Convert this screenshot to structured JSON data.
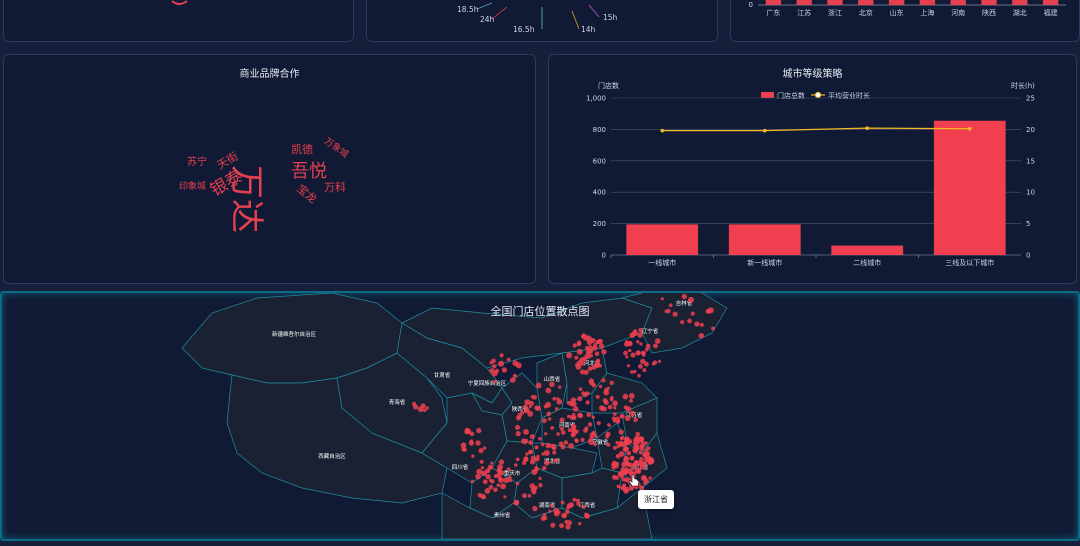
{
  "top_left": {
    "labels": []
  },
  "top_mid": {
    "labels": [
      "18.5h",
      "24h",
      "16.5h",
      "15h",
      "14h"
    ]
  },
  "top_right": {
    "categories": [
      "广东",
      "江苏",
      "浙江",
      "北京",
      "山东",
      "上海",
      "河南",
      "陕西",
      "湖北",
      "福建"
    ],
    "zero": "0"
  },
  "brand_cloud": {
    "title": "商业品牌合作",
    "words": [
      {
        "text": "万达",
        "size": 34
      },
      {
        "text": "银泰",
        "size": 17
      },
      {
        "text": "吾悦",
        "size": 18
      },
      {
        "text": "凯德",
        "size": 11
      },
      {
        "text": "天街",
        "size": 11
      },
      {
        "text": "苏宁",
        "size": 10
      },
      {
        "text": "印象城",
        "size": 9
      },
      {
        "text": "宝龙",
        "size": 11
      },
      {
        "text": "万科",
        "size": 11
      },
      {
        "text": "万象城",
        "size": 9
      }
    ],
    "color": "#e5404f"
  },
  "city_tier": {
    "title": "城市等级策略",
    "y_left_label": "门店数",
    "y_right_label": "时长(h)",
    "legend": [
      "门店总数",
      "平均营业时长"
    ],
    "left_ticks": [
      "0",
      "200",
      "400",
      "600",
      "800",
      "1,000"
    ],
    "right_ticks": [
      "0",
      "5",
      "10",
      "15",
      "20",
      "25"
    ]
  },
  "chart_data": {
    "type": "bar",
    "categories": [
      "一线城市",
      "新一线城市",
      "二线城市",
      "三线及以下城市"
    ],
    "series": [
      {
        "name": "门店总数",
        "type": "bar",
        "values": [
          195,
          195,
          60,
          855
        ],
        "color": "#f0404f"
      },
      {
        "name": "平均营业时长",
        "type": "line",
        "values": [
          19.8,
          19.8,
          20.2,
          20.1
        ],
        "color": "#f5b81e"
      }
    ],
    "ylabel": "门店数",
    "ylim": [
      0,
      1000
    ],
    "y2label": "时长(h)",
    "y2lim": [
      0,
      25
    ],
    "grid": true,
    "legend_position": "top-center"
  },
  "map": {
    "title": "全国门店位置散点图",
    "dot_color": "#f0404f",
    "province_labels": [
      "新疆维吾尔自治区",
      "西藏自治区",
      "青海省",
      "甘肃省",
      "宁夏回族自治区",
      "四川省",
      "重庆市",
      "贵州省",
      "湖南省",
      "江西省",
      "河南省",
      "山西省",
      "河北省",
      "陕西省",
      "湖北省",
      "辽宁省",
      "吉林省",
      "安徽省",
      "江苏省",
      "浙江省"
    ],
    "tooltip": "浙江省"
  }
}
